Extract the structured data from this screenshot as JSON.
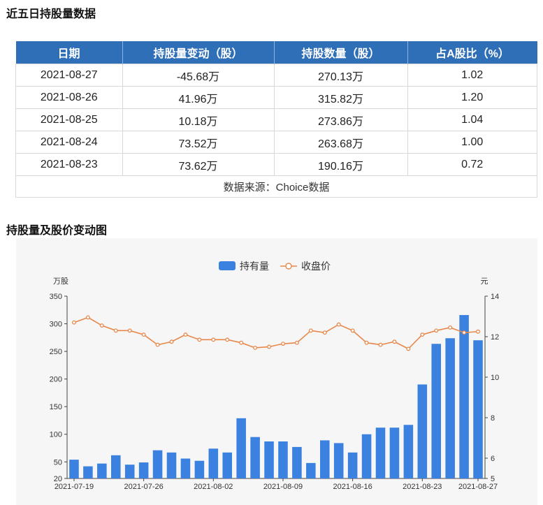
{
  "section1_title": "近五日持股量数据",
  "section2_title": "持股量及股价变动图",
  "table": {
    "headers": [
      "日期",
      "持股量变动（股）",
      "持股数量（股）",
      "占A股比（%）"
    ],
    "rows": [
      {
        "date": "2021-08-27",
        "change": "-45.68万",
        "holding": "270.13万",
        "ratio": "1.02",
        "sign": "neg"
      },
      {
        "date": "2021-08-26",
        "change": "41.96万",
        "holding": "315.82万",
        "ratio": "1.20",
        "sign": "pos"
      },
      {
        "date": "2021-08-25",
        "change": "10.18万",
        "holding": "273.86万",
        "ratio": "1.04",
        "sign": "pos"
      },
      {
        "date": "2021-08-24",
        "change": "73.52万",
        "holding": "263.68万",
        "ratio": "1.00",
        "sign": "pos"
      },
      {
        "date": "2021-08-23",
        "change": "73.62万",
        "holding": "190.16万",
        "ratio": "0.72",
        "sign": "pos"
      }
    ],
    "source": "数据来源：Choice数据"
  },
  "colors": {
    "header_bg": "#2f6fb8",
    "negative": "#2a9a2a",
    "positive": "#d42a2a",
    "bar": "#3b82e0",
    "line": "#e8874a"
  },
  "chart_data": {
    "type": "bar",
    "legend": [
      "持有量",
      "收盘价"
    ],
    "legend_position": "top-center",
    "left_unit": "万股",
    "right_unit": "元",
    "left_ylim": [
      20,
      350
    ],
    "left_ticks": [
      20,
      50,
      100,
      150,
      200,
      250,
      300,
      350
    ],
    "right_ylim": [
      5,
      14
    ],
    "right_ticks": [
      5,
      6,
      8,
      10,
      12,
      14
    ],
    "x_tick_labels": [
      "2021-07-19",
      "2021-07-26",
      "2021-08-02",
      "2021-08-09",
      "2021-08-16",
      "2021-08-23",
      "2021-08-27"
    ],
    "x_tick_index": [
      0,
      5,
      10,
      15,
      20,
      25,
      29
    ],
    "dates": [
      "2021-07-19",
      "2021-07-20",
      "2021-07-21",
      "2021-07-22",
      "2021-07-23",
      "2021-07-26",
      "2021-07-27",
      "2021-07-28",
      "2021-07-29",
      "2021-07-30",
      "2021-08-02",
      "2021-08-03",
      "2021-08-04",
      "2021-08-05",
      "2021-08-06",
      "2021-08-09",
      "2021-08-10",
      "2021-08-11",
      "2021-08-12",
      "2021-08-13",
      "2021-08-16",
      "2021-08-17",
      "2021-08-18",
      "2021-08-19",
      "2021-08-20",
      "2021-08-23",
      "2021-08-24",
      "2021-08-25",
      "2021-08-26",
      "2021-08-27"
    ],
    "series": [
      {
        "name": "持有量",
        "type": "bar",
        "axis": "left",
        "values": [
          54,
          42,
          47,
          62,
          45,
          49,
          71,
          67,
          56,
          52,
          74,
          67,
          129,
          95,
          87,
          87,
          77,
          48,
          89,
          84,
          67,
          100,
          112,
          112,
          117,
          190.16,
          263.68,
          273.86,
          315.82,
          270.13
        ]
      },
      {
        "name": "收盘价",
        "type": "line",
        "axis": "right",
        "values": [
          12.7,
          12.95,
          12.55,
          12.3,
          12.3,
          12.1,
          11.6,
          11.75,
          12.1,
          11.85,
          11.85,
          11.85,
          11.7,
          11.45,
          11.5,
          11.65,
          11.7,
          12.3,
          12.2,
          12.6,
          12.3,
          11.7,
          11.6,
          11.75,
          11.4,
          12.1,
          12.3,
          12.45,
          12.2,
          12.25
        ]
      }
    ]
  }
}
